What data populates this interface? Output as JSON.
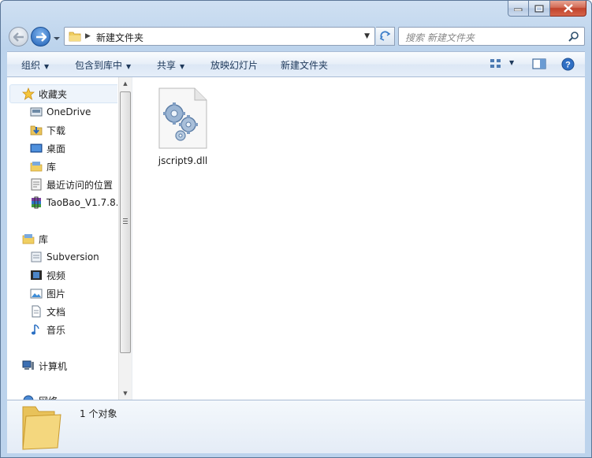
{
  "address": {
    "path": "新建文件夹",
    "search_placeholder": "搜索 新建文件夹"
  },
  "toolbar": {
    "organize": "组织",
    "include_in_library": "包含到库中",
    "share": "共享",
    "slideshow": "放映幻灯片",
    "new_folder": "新建文件夹"
  },
  "navigation": {
    "favorites": {
      "label": "收藏夹",
      "items": [
        {
          "label": "OneDrive",
          "icon": "onedrive-icon"
        },
        {
          "label": "下载",
          "icon": "downloads-icon"
        },
        {
          "label": "桌面",
          "icon": "desktop-icon"
        },
        {
          "label": "库",
          "icon": "library-icon"
        },
        {
          "label": "最近访问的位置",
          "icon": "recent-places-icon"
        },
        {
          "label": "TaoBao_V1.7.8.",
          "icon": "winrar-icon"
        }
      ]
    },
    "libraries": {
      "label": "库",
      "items": [
        {
          "label": "Subversion",
          "icon": "document-library-icon"
        },
        {
          "label": "视频",
          "icon": "video-icon"
        },
        {
          "label": "图片",
          "icon": "pictures-icon"
        },
        {
          "label": "文档",
          "icon": "documents-icon"
        },
        {
          "label": "音乐",
          "icon": "music-icon"
        }
      ]
    },
    "computer": {
      "label": "计算机"
    },
    "network": {
      "label": "网络"
    }
  },
  "files": [
    {
      "name": "jscript9.dll",
      "icon": "dll-file-icon"
    }
  ],
  "details": {
    "item_count": "1 个对象"
  },
  "colors": {
    "frame": "#bcd3ec",
    "toolbar_text": "#1e395b",
    "close_button": "#c1432c"
  }
}
